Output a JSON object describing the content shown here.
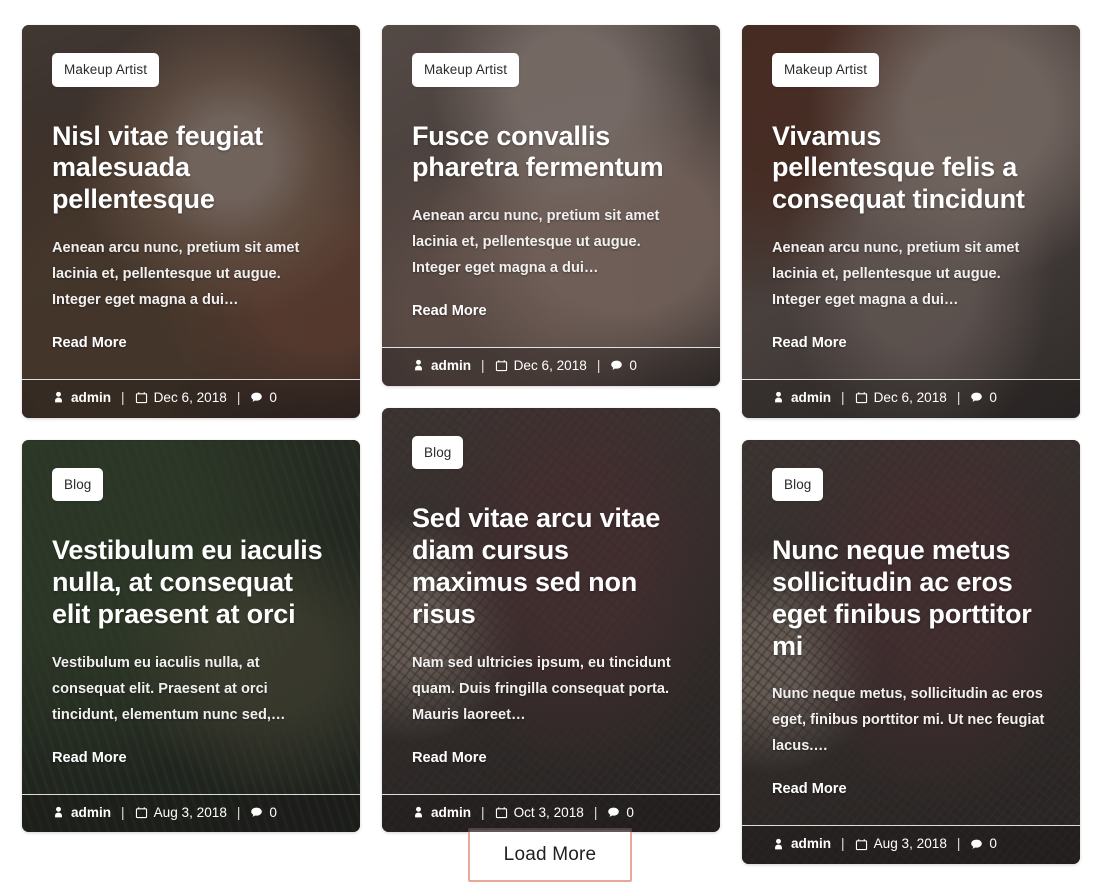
{
  "colors": {
    "page_background": "#ffffff",
    "card_overlay": "rgba(40,38,38,0.62)",
    "badge_background": "#ffffff",
    "badge_text": "#2b2b2b",
    "text_on_card": "#ffffff",
    "load_more_border": "#e8a898",
    "load_more_text": "#1f1f1f"
  },
  "posts": [
    {
      "id": "post-1",
      "category": "Makeup Artist",
      "title": "Nisl vitae feugiat malesuada pellentesque",
      "excerpt": "Aenean arcu nunc, pretium sit amet lacinia et, pellentesque ut augue. Integer eget magna a dui…",
      "read_more": "Read More",
      "author": "admin",
      "date": "Dec 6, 2018",
      "comments": "0",
      "separator": "|",
      "photo": "ph-salon",
      "icons": {
        "author": "user-icon",
        "date": "calendar-icon",
        "comments": "comment-icon"
      }
    },
    {
      "id": "post-2",
      "category": "Makeup Artist",
      "title": "Fusce convallis pharetra fermentum",
      "excerpt": "Aenean arcu nunc, pretium sit amet lacinia et, pellentesque ut augue. Integer eget magna a dui…",
      "read_more": "Read More",
      "author": "admin",
      "date": "Dec 6, 2018",
      "comments": "0",
      "separator": "|",
      "photo": "ph-face",
      "icons": {
        "author": "user-icon",
        "date": "calendar-icon",
        "comments": "comment-icon"
      }
    },
    {
      "id": "post-3",
      "category": "Makeup Artist",
      "title": "Vivamus pellentesque felis a consequat tincidunt",
      "excerpt": "Aenean arcu nunc, pretium sit amet lacinia et, pellentesque ut augue. Integer eget magna a dui…",
      "read_more": "Read More",
      "author": "admin",
      "date": "Dec 6, 2018",
      "comments": "0",
      "separator": "|",
      "photo": "ph-eye",
      "icons": {
        "author": "user-icon",
        "date": "calendar-icon",
        "comments": "comment-icon"
      }
    },
    {
      "id": "post-4",
      "category": "Blog",
      "title": "Vestibulum eu iaculis nulla, at consequat elit praesent at orci",
      "excerpt": "Vestibulum eu iaculis nulla, at consequat elit. Praesent at orci tincidunt, elementum nunc sed,…",
      "read_more": "Read More",
      "author": "admin",
      "date": "Aug 3, 2018",
      "comments": "0",
      "separator": "|",
      "photo": "ph-palm",
      "icons": {
        "author": "user-icon",
        "date": "calendar-icon",
        "comments": "comment-icon"
      }
    },
    {
      "id": "post-5",
      "category": "Blog",
      "title": "Sed vitae arcu vitae diam cursus maximus sed non risus",
      "excerpt": "Nam sed ultricies ipsum, eu tincidunt quam. Duis fringilla consequat porta. Mauris laoreet…",
      "read_more": "Read More",
      "author": "admin",
      "date": "Oct 3, 2018",
      "comments": "0",
      "separator": "|",
      "photo": "ph-tree",
      "icons": {
        "author": "user-icon",
        "date": "calendar-icon",
        "comments": "comment-icon"
      }
    },
    {
      "id": "post-6",
      "category": "Blog",
      "title": "Nunc neque metus sollicitudin ac eros eget finibus porttitor mi",
      "excerpt": "Nunc neque metus, sollicitudin ac eros eget, finibus porttitor mi. Ut nec feugiat lacus.…",
      "read_more": "Read More",
      "author": "admin",
      "date": "Aug 3, 2018",
      "comments": "0",
      "separator": "|",
      "photo": "ph-tree",
      "icons": {
        "author": "user-icon",
        "date": "calendar-icon",
        "comments": "comment-icon"
      }
    }
  ],
  "load_more": {
    "label": "Load More"
  }
}
